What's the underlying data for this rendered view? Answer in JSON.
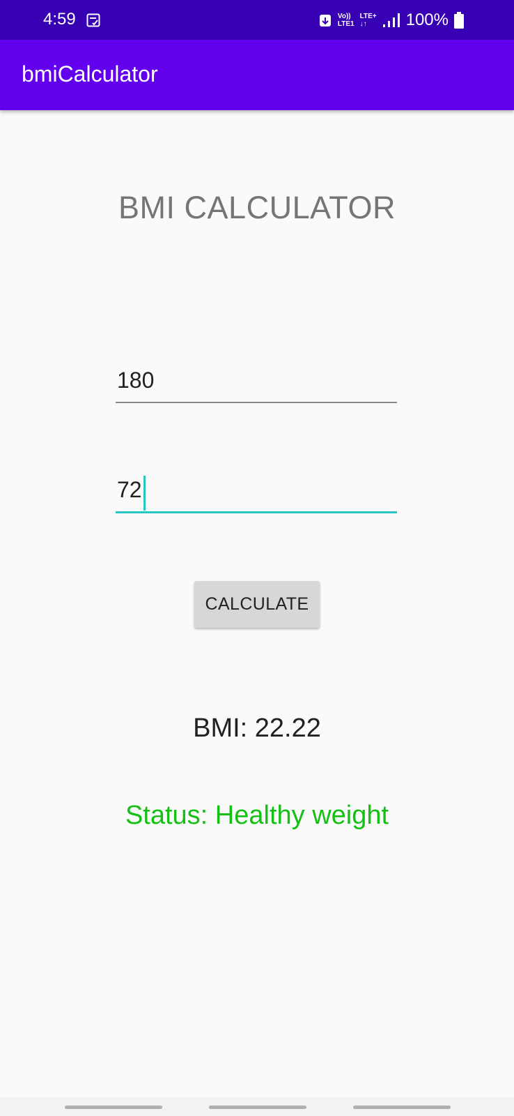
{
  "status_bar": {
    "time": "4:59",
    "volte_label": "Vo))",
    "lte_top": "LTE+",
    "lte_bottom": "LTE1",
    "battery": "100%"
  },
  "app_bar": {
    "title": "bmiCalculator"
  },
  "main": {
    "heading": "BMI CALCULATOR",
    "height_value": "180",
    "weight_value": "72",
    "calculate_label": "CALCULATE",
    "bmi_result": "BMI: 22.22",
    "status_result": "Status: Healthy weight"
  },
  "colors": {
    "status_bar": "#3700b3",
    "app_bar": "#6200ee",
    "accent": "#26c6c2",
    "status_green": "#14c014"
  },
  "icons": [
    "note-icon",
    "data-saver-icon",
    "signal-icon",
    "battery-icon"
  ]
}
